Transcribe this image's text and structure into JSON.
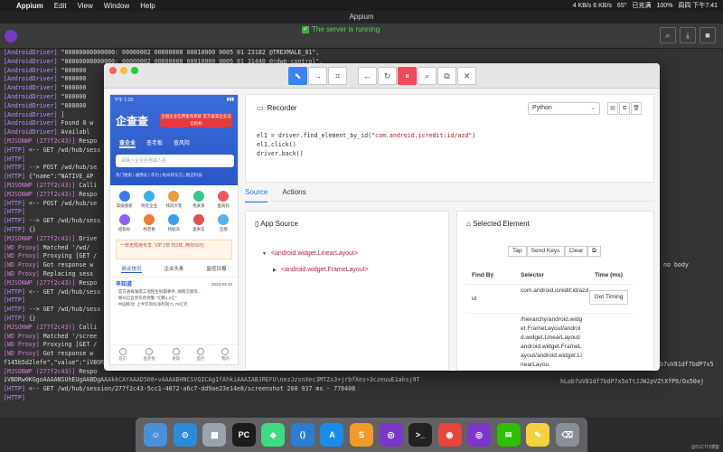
{
  "menubar": {
    "app_name": "Appium",
    "items": [
      "Edit",
      "View",
      "Window",
      "Help"
    ],
    "status": [
      "4 KB/s 6 KB/s",
      "65°",
      "已充满",
      "100%",
      "周四 下午7:41"
    ]
  },
  "appium": {
    "window_title": "Appium",
    "server_status": "The server is running"
  },
  "console": {
    "lines": [
      {
        "tag": "[AndroidDriver]",
        "text": "\"00000000000000: 00000002 00000000 00010000 0005 01 23182 @TREXMALE_01\","
      },
      {
        "tag": "[AndroidDriver]",
        "text": "\"00000000000000: 00000002 00000000 00010000 0005 01 31440 @jdwp-control\","
      },
      {
        "tag": "[AndroidDriver]",
        "text": "\"000000"
      },
      {
        "tag": "[AndroidDriver]",
        "text": "\"000000"
      },
      {
        "tag": "[AndroidDriver]",
        "text": "\"000000"
      },
      {
        "tag": "[AndroidDriver]",
        "text": "\"000000"
      },
      {
        "tag": "[AndroidDriver]",
        "text": "\"000000"
      },
      {
        "tag": "[AndroidDriver]",
        "text": "]"
      },
      {
        "tag": "[AndroidDriver]",
        "text": "Found 0 w"
      },
      {
        "tag": "[AndroidDriver]",
        "text": "Availabl"
      },
      {
        "tag": "[MJSONWP (277f2c43)]",
        "text": "Respo"
      },
      {
        "tag": "[HTTP]",
        "text": "<-- GET /wd/hub/sess"
      },
      {
        "tag": "[HTTP]",
        "text": ""
      },
      {
        "tag": "[HTTP]",
        "text": "--> POST /wd/hub/se"
      },
      {
        "tag": "[HTTP]",
        "text": "{\"name\":\"NATIVE_AP"
      },
      {
        "tag": "[MJSONWP (277f2c43)]",
        "text": "Calli"
      },
      {
        "tag": "[MJSONWP (277f2c43)]",
        "text": "Respo"
      },
      {
        "tag": "[HTTP]",
        "text": "<-- POST /wd/hub/se"
      },
      {
        "tag": "[HTTP]",
        "text": ""
      },
      {
        "tag": "[HTTP]",
        "text": "--> GET /wd/hub/sess"
      },
      {
        "tag": "[HTTP]",
        "text": "{}"
      },
      {
        "tag": "[MJSONWP (277f2c43)]",
        "text": "Drive"
      },
      {
        "tag": "[WD Proxy]",
        "text": "Matched '/wd/"
      },
      {
        "tag": "[WD Proxy]",
        "text": "Proxying [GET /"
      },
      {
        "tag": "[WD Proxy]",
        "text": "Got response w"
      },
      {
        "tag": "[WD Proxy]",
        "text": "Replacing sess"
      },
      {
        "tag": "[MJSONWP (277f2c43)]",
        "text": "Respo"
      },
      {
        "tag": "[HTTP]",
        "text": "<-- GET /wd/hub/sess"
      },
      {
        "tag": "[HTTP]",
        "text": ""
      },
      {
        "tag": "[HTTP]",
        "text": "--> GET /wd/hub/sess"
      },
      {
        "tag": "[HTTP]",
        "text": "{}"
      },
      {
        "tag": "[MJSONWP (277f2c43)]",
        "text": "Calli"
      },
      {
        "tag": "[WD Proxy]",
        "text": "Matched '/scree"
      },
      {
        "tag": "[WD Proxy]",
        "text": "Proxying [GET /"
      },
      {
        "tag": "[WD Proxy]",
        "text": "Got response w"
      },
      {
        "tag": "",
        "text": "f145b5d2lefe\",\"value\":\"iVBOR"
      },
      {
        "tag": "[MJSONWP (277f2c43)]",
        "text": "Respo"
      },
      {
        "tag": "",
        "text": "iVBORw0KGgoAAAANSUhEUgAABDgAAAkkCAYAAAD508+vAAAABHNCSVQICAgIfAhkiAAAIABJREFU\\nezJzsnXec3MTZx3+jrbfXez+3czeuuE1aksj9T"
      },
      {
        "tag": "[HTTP]",
        "text": "<-- GET /wd/hub/session/277f2c43-5cc1-4072-a6c7-dd9ae23e14e8/screenshot 200 937 ms - 778408"
      },
      {
        "tag": "[HTTP]",
        "text": ""
      }
    ],
    "overflow_1": "no body",
    "overflow_2": "b7uV81df7bdP7x5",
    "overflow_3": "hLob7uV81df7bdP7x5oTtJJW2pVZtXfP9/Ox50aj"
  },
  "inspector": {
    "toolbar": [
      "select-element",
      "swipe",
      "tap-coordinates",
      "back",
      "refresh",
      "pause-recording",
      "search",
      "copy-xml",
      "quit"
    ],
    "recorder": {
      "title": "Recorder",
      "language": "Python",
      "code": [
        {
          "pre": "el1 = driver.find_element_by_id(",
          "str": "\"com.android.icredit:id/azd\"",
          "post": ")"
        },
        {
          "pre": "el1.click()",
          "str": "",
          "post": ""
        },
        {
          "pre": "driver.back()",
          "str": "",
          "post": ""
        }
      ]
    },
    "tabs": [
      "Source",
      "Actions"
    ],
    "source": {
      "title": "App Source",
      "nodes": [
        "<android.widget.LinearLayout>",
        "<android.widget.FrameLayout>"
      ]
    },
    "selected": {
      "title": "Selected Element",
      "buttons": [
        "Tap",
        "Send Keys",
        "Clear"
      ],
      "headers": [
        "Find By",
        "Selector",
        "Time (ms)"
      ],
      "rows": [
        {
          "find_by": "id",
          "selector": "com.android.icredit:id/azd",
          "action": "Get Timing"
        },
        {
          "find_by": "",
          "selector": "/hierarchy/android.widget.FrameLayout/android.widget.LinearLayout/android.widget.FrameLayout/android.widget.LinearLayou",
          "action": ""
        }
      ]
    }
  },
  "phone": {
    "time": "下午 1:10",
    "logo": "企查查",
    "banner": "全国企业信用查询系统 官方备案企业征信机构",
    "tabs": [
      "查企业",
      "查老板",
      "查风险"
    ],
    "search_placeholder": "请输入企业名称或人名",
    "hot": "热门搜索 | 通用仪 | 华为 | 杭州新东方 | 鹏迈科技",
    "grid": [
      "高级搜索",
      "附近企业",
      "找同大客",
      "找关系",
      "查商标",
      "招投标",
      "找老板",
      "找股东",
      "查失信",
      "全部"
    ],
    "ad": "一年无限用专享· VIP 2年 仅1年, 两年69元",
    "subtabs": [
      "商业快讯",
      "企业头条",
      "监控日报"
    ],
    "news_title": "早知道",
    "news_date": "2023-03-10",
    "news": [
      "· 官方通报湖南工地陌生坍塌事件, 湖南交建等...",
      "· 郑州已自然灰色预警 \"切断1.5亿\"",
      "· 中国移动: 上半年目标净利润71.79亿元"
    ],
    "bottom": [
      "首页",
      "查老板",
      "发现",
      "监控",
      "我的"
    ]
  },
  "dock": [
    "Finder",
    "Safari",
    "Launchpad",
    "PyCharm",
    "Android Studio",
    "VS Code",
    "App Store",
    "Sublime",
    "Appium Mac",
    "Terminal",
    "Chrome",
    "Appium",
    "WeChat",
    "Notes",
    "Trash"
  ],
  "watermark": "@51CTO博客"
}
